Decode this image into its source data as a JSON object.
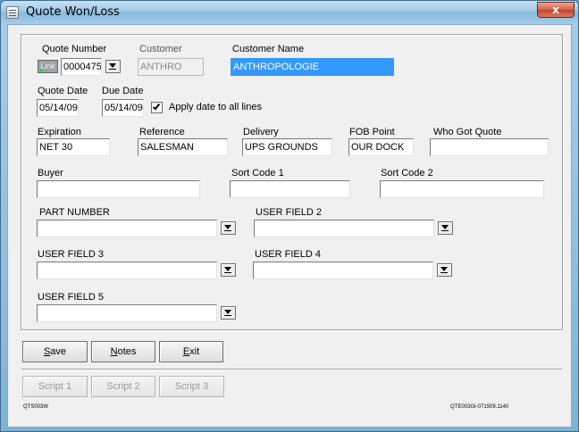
{
  "window": {
    "title": "Quote Won/Loss",
    "close_label": "x"
  },
  "form": {
    "quote_number": {
      "label": "Quote Number",
      "value": "0000475",
      "link_label": "Link"
    },
    "customer": {
      "label": "Customer",
      "value": "ANTHRO"
    },
    "customer_name": {
      "label": "Customer Name",
      "value": "ANTHROPOLOGIE"
    },
    "quote_date": {
      "label": "Quote Date",
      "value": "05/14/09"
    },
    "due_date": {
      "label": "Due Date",
      "value": "05/14/09"
    },
    "apply_date": {
      "label": "Apply date to all lines",
      "checked": true
    },
    "expiration": {
      "label": "Expiration",
      "value": "NET 30"
    },
    "reference": {
      "label": "Reference",
      "value": "SALESMAN"
    },
    "delivery": {
      "label": "Delivery",
      "value": "UPS GROUNDS"
    },
    "fob_point": {
      "label": "FOB Point",
      "value": "OUR DOCK"
    },
    "who_got_quote": {
      "label": "Who Got Quote",
      "value": ""
    },
    "buyer": {
      "label": "Buyer",
      "value": ""
    },
    "sort_code_1": {
      "label": "Sort Code 1",
      "value": ""
    },
    "sort_code_2": {
      "label": "Sort Code 2",
      "value": ""
    },
    "part_number": {
      "label": "PART NUMBER",
      "value": ""
    },
    "user_field_2": {
      "label": "USER FIELD 2",
      "value": ""
    },
    "user_field_3": {
      "label": "USER FIELD 3",
      "value": ""
    },
    "user_field_4": {
      "label": "USER FIELD 4",
      "value": ""
    },
    "user_field_5": {
      "label": "USER FIELD 5",
      "value": ""
    }
  },
  "buttons": {
    "save": "Save",
    "notes": "Notes",
    "exit": "Exit",
    "script1": "Script 1",
    "script2": "Script 2",
    "script3": "Script 3"
  },
  "footer": {
    "form_id": "QTS003W",
    "version": "QTE003GI-071509.1140"
  }
}
